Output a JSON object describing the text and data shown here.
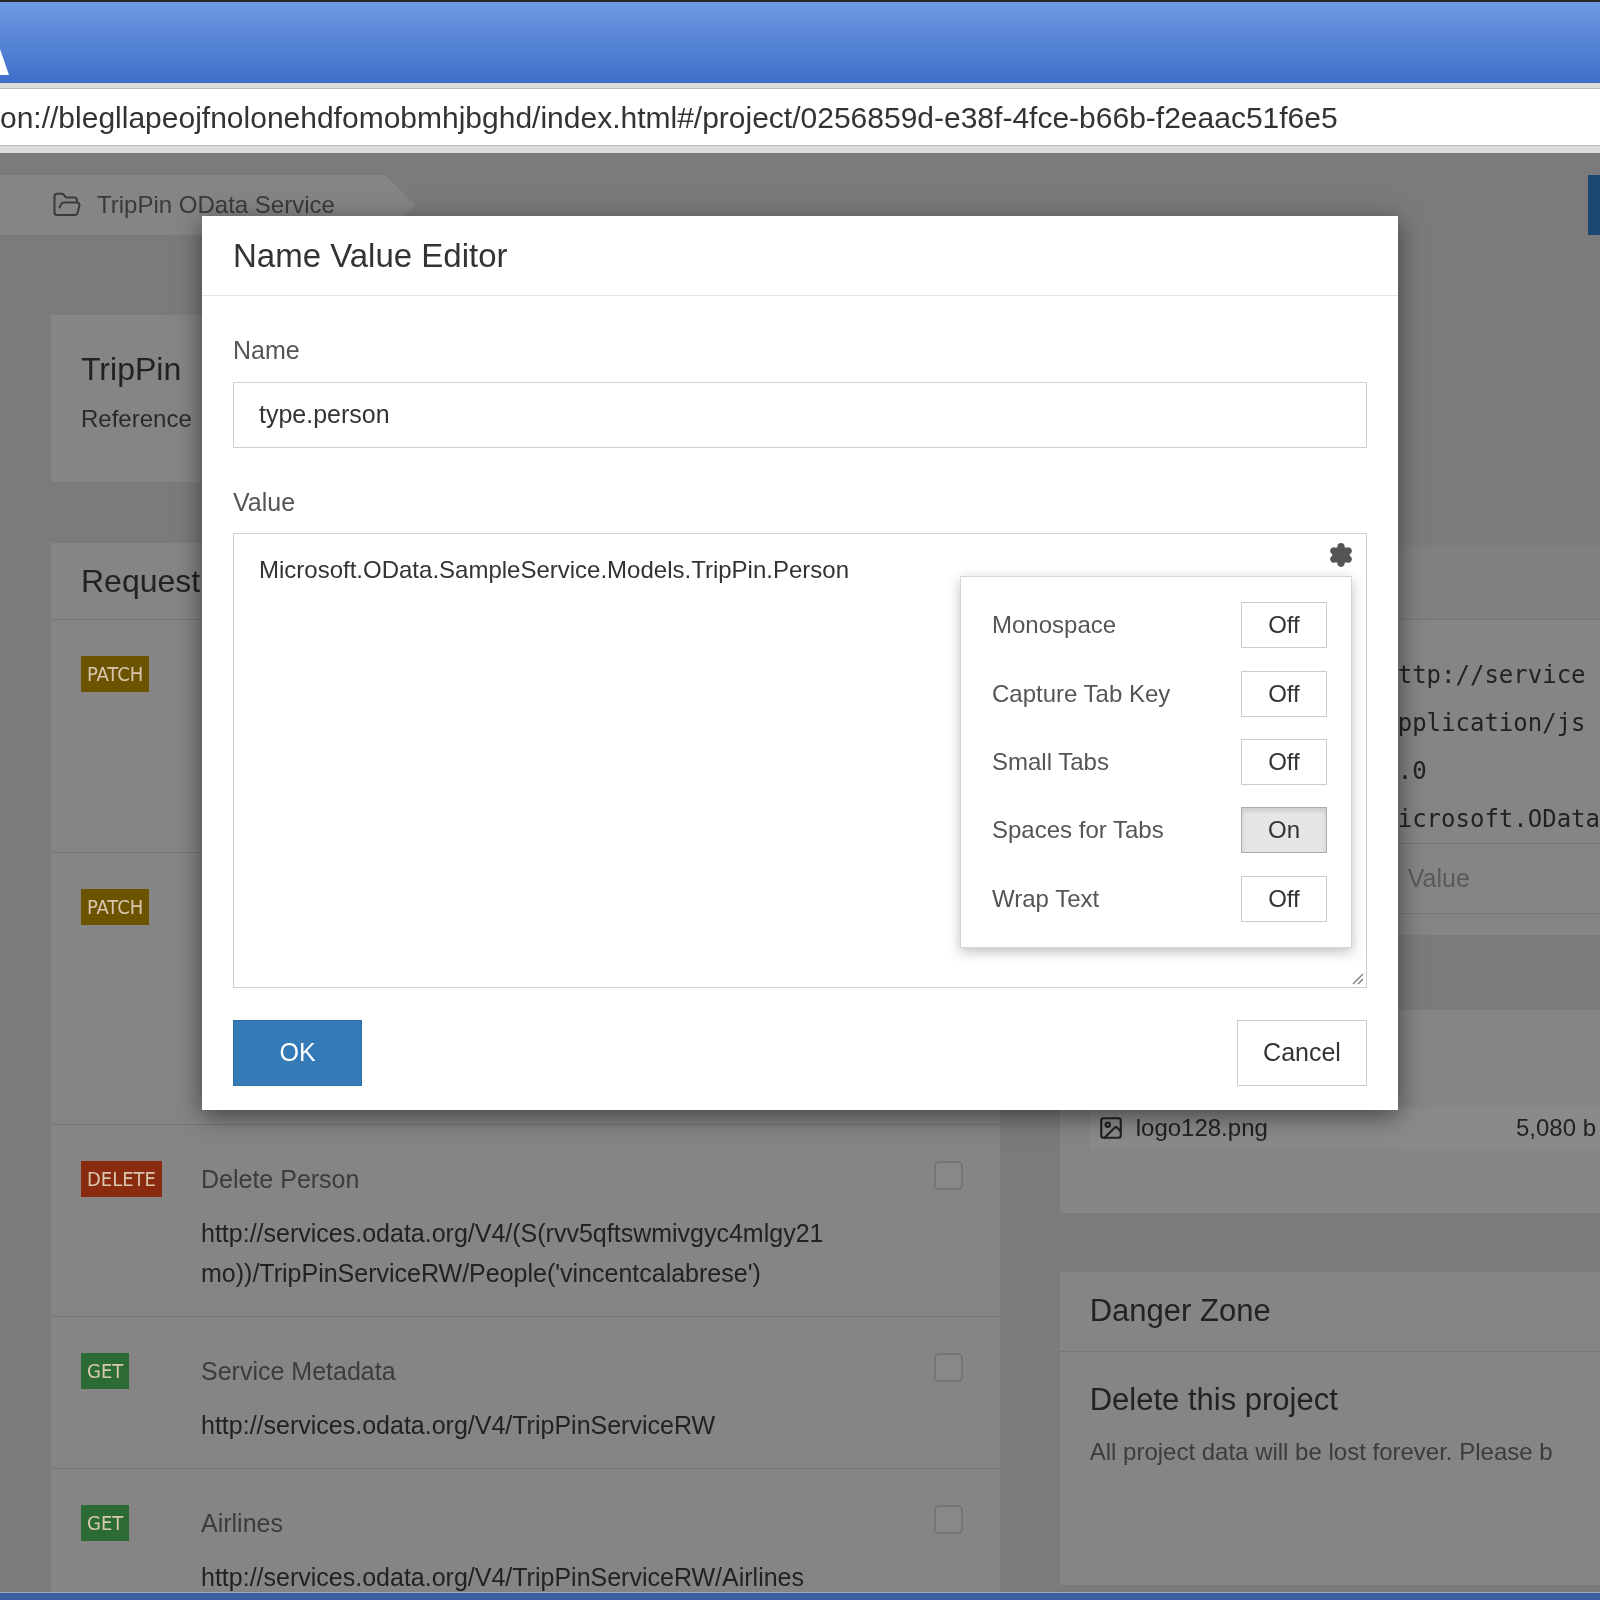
{
  "browser": {
    "address": "on://blegllapeojfnolonehdfomobmhjbghd/index.html#/project/0256859d-e38f-4fce-b66b-f2eaac51f6e5"
  },
  "breadcrumb": {
    "label": "TripPin OData Service"
  },
  "project_card": {
    "title": "TripPin",
    "subtitle": "Reference"
  },
  "requests": {
    "title": "Request",
    "rows": [
      {
        "method": "PATCH",
        "color": "#6b5300"
      },
      {
        "method": "PATCH",
        "color": "#6b5300"
      },
      {
        "method": "DELETE",
        "color": "#8a2a0e",
        "name": "Delete Person",
        "url_lines": [
          "http://services.odata.org/V4/(S(rvv5qftswmivgyc4mlgy21",
          "mo))/TripPinServiceRW/People('vincentcalabrese')"
        ],
        "checked": false
      },
      {
        "method": "GET",
        "color": "#2d6b35",
        "name": "Service Metadata",
        "url_lines": [
          "http://services.odata.org/V4/TripPinServiceRW"
        ],
        "checked": false
      },
      {
        "method": "GET",
        "color": "#2d6b35",
        "name": "Airlines",
        "url_lines": [
          "http://services.odata.org/V4/TripPinServiceRW/Airlines"
        ],
        "checked": false
      }
    ]
  },
  "headers_card": {
    "lines": [
      "ttp://service",
      "pplication/js",
      ".0",
      "icrosoft.OData"
    ],
    "value_field": {
      "placeholder": "Value"
    }
  },
  "files": [
    {
      "name": "logo128.png",
      "size": "5,080 b"
    }
  ],
  "danger_zone": {
    "title": "Danger Zone",
    "item_title": "Delete this project",
    "item_text": "All project data will be lost forever. Please b"
  },
  "dialog": {
    "title": "Name Value Editor",
    "name_label": "Name",
    "name_value": "type.person",
    "value_label": "Value",
    "value_text": "Microsoft.OData.SampleService.Models.TripPin.Person",
    "settings": [
      {
        "label": "Monospace",
        "value": "Off",
        "on": false
      },
      {
        "label": "Capture Tab Key",
        "value": "Off",
        "on": false
      },
      {
        "label": "Small Tabs",
        "value": "Off",
        "on": false
      },
      {
        "label": "Spaces for Tabs",
        "value": "On",
        "on": true
      },
      {
        "label": "Wrap Text",
        "value": "Off",
        "on": false
      }
    ],
    "ok": "OK",
    "cancel": "Cancel"
  }
}
